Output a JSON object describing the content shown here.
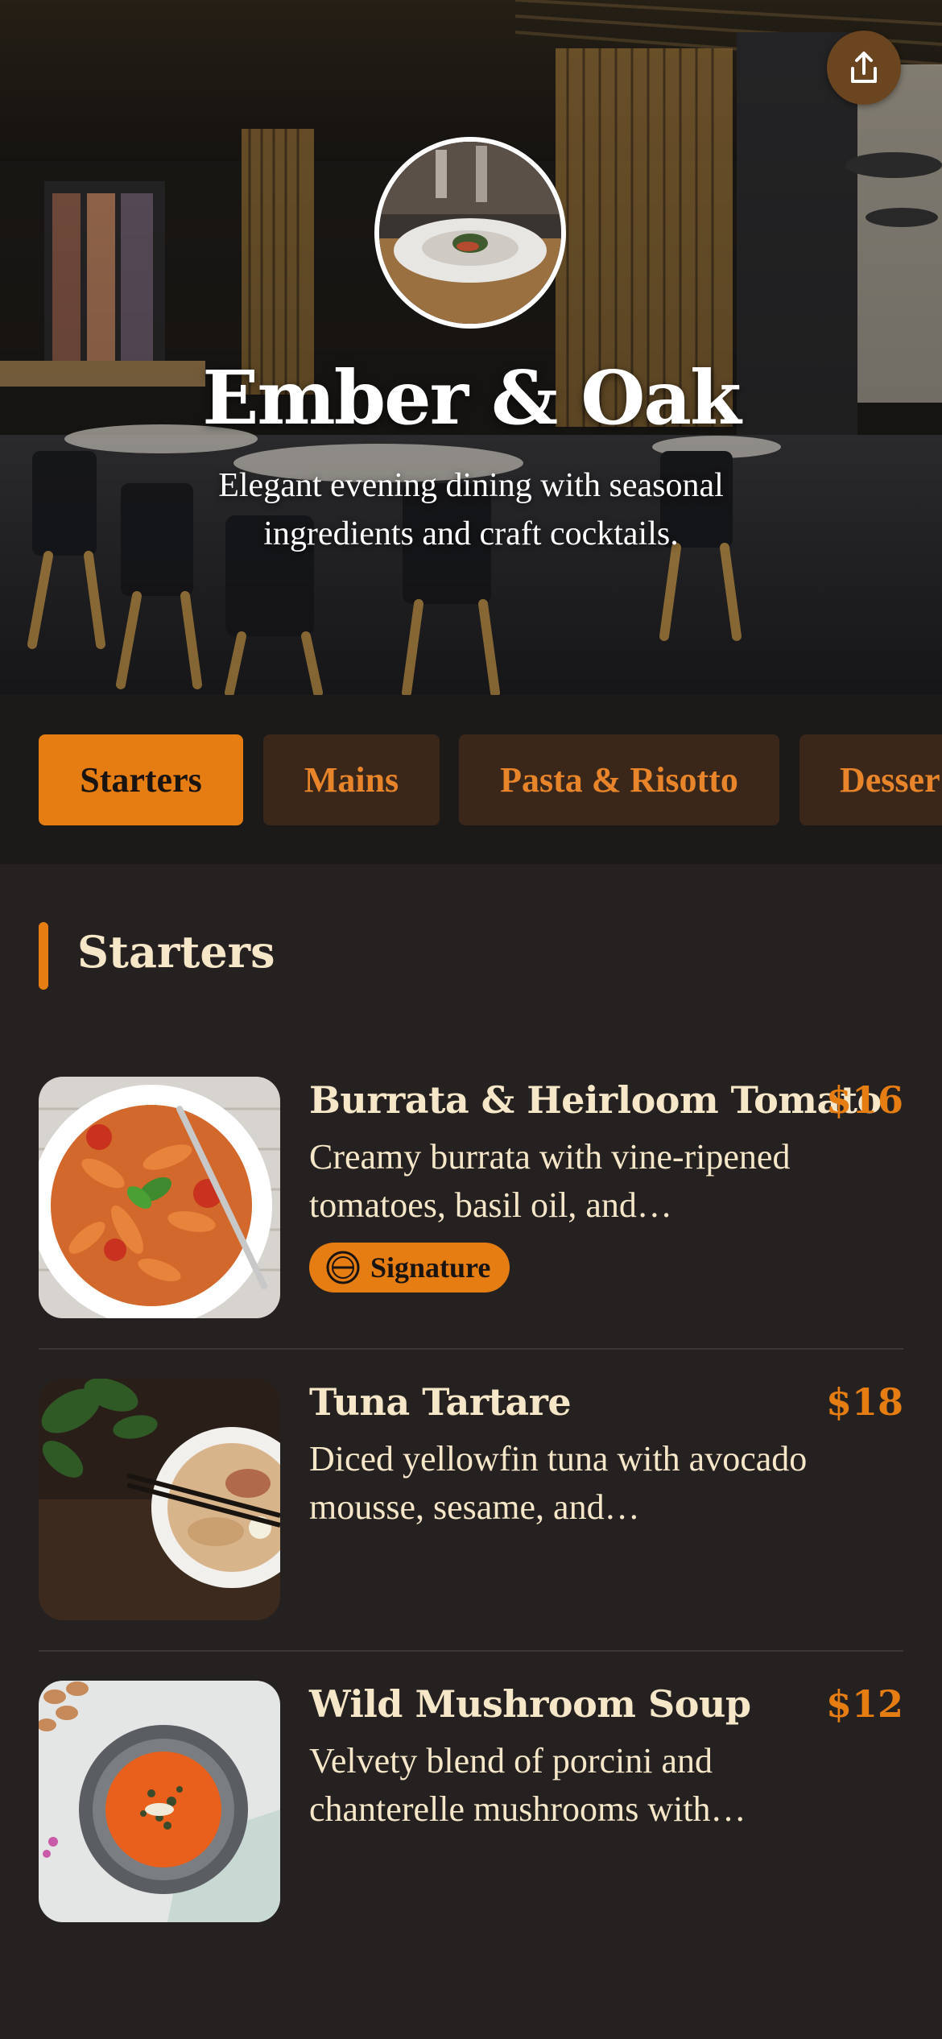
{
  "hero": {
    "title": "Ember & Oak",
    "subtitle": "Elegant evening dining with seasonal ingredients and craft cocktails.",
    "share_icon": "share-icon"
  },
  "tabs": [
    {
      "label": "Starters",
      "active": true
    },
    {
      "label": "Mains",
      "active": false
    },
    {
      "label": "Pasta & Risotto",
      "active": false
    },
    {
      "label": "Desser",
      "active": false
    }
  ],
  "section": {
    "title": "Starters"
  },
  "items": [
    {
      "name": "Burrata & Heirloom Tomato",
      "price": "$16",
      "description": "Creamy burrata with vine-ripened tomatoes, basil oil, and…",
      "badge": {
        "label": "Signature",
        "icon": "staff-pick-icon"
      }
    },
    {
      "name": "Tuna Tartare",
      "price": "$18",
      "description": "Diced yellowfin tuna with avocado mousse, sesame, and…"
    },
    {
      "name": "Wild Mushroom Soup",
      "price": "$12",
      "description": "Velvety blend of porcini and chanterelle mushrooms with…"
    }
  ],
  "colors": {
    "accent": "#e57d12",
    "background": "#262121",
    "tab_bar": "#1c1a19",
    "tab_inactive": "#3a271a",
    "text_cream": "#f6e7c8"
  }
}
